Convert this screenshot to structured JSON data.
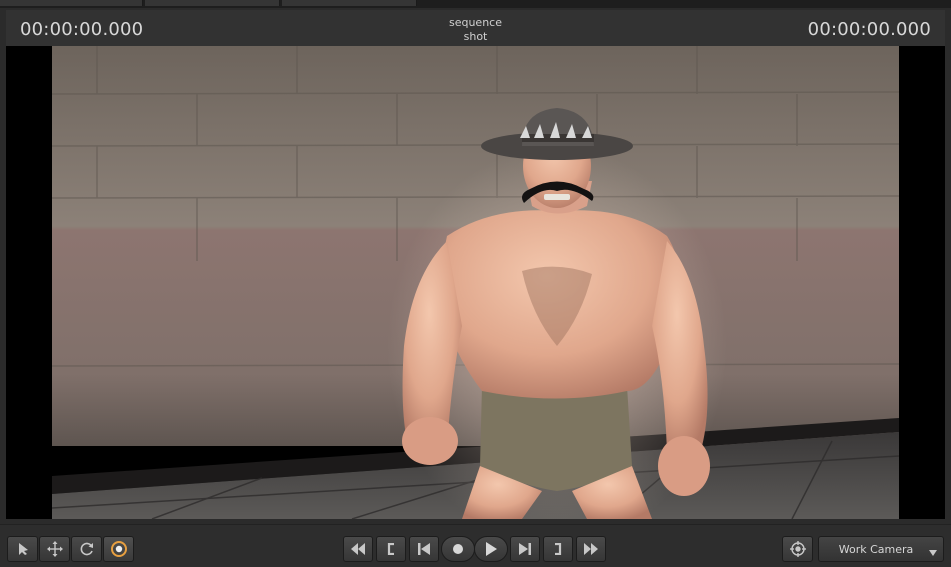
{
  "header": {
    "timecode_left": "00:00:00.000",
    "timecode_right": "00:00:00.000",
    "sequence_label": "sequence",
    "shot_label": "shot"
  },
  "viewport": {
    "content": "3D render of a shirtless muscular character in a cowboy hat and mustache standing in front of a tiled concrete wall"
  },
  "toolbar": {
    "tools": [
      {
        "icon": "select-arrow-icon"
      },
      {
        "icon": "move-arrows-icon"
      },
      {
        "icon": "rotate-icon"
      },
      {
        "icon": "target-ring-icon"
      }
    ],
    "transport": [
      {
        "icon": "rewind-icon"
      },
      {
        "icon": "mark-in-icon"
      },
      {
        "icon": "skip-to-start-icon"
      },
      {
        "icon": "record-icon"
      },
      {
        "icon": "play-icon"
      },
      {
        "icon": "skip-to-end-icon"
      },
      {
        "icon": "mark-out-icon"
      },
      {
        "icon": "fast-forward-icon"
      }
    ],
    "camera_target_icon": "crosshair-icon",
    "camera_select": "Work Camera"
  },
  "colors": {
    "panel_bg": "#2b2b2b",
    "header_bg": "#323232",
    "accent_orange": "#e8a040",
    "wall": "#8a7e74"
  }
}
